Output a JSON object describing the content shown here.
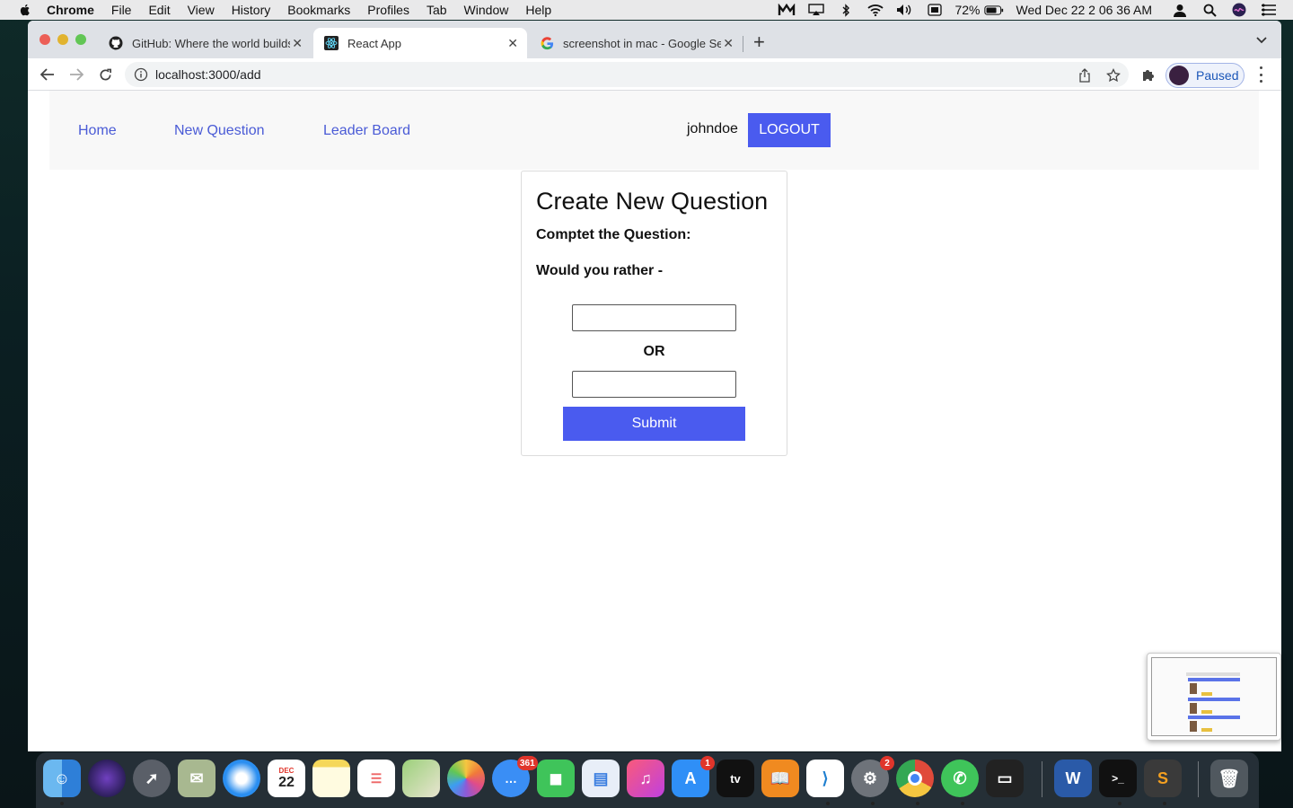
{
  "menubar": {
    "app": "Chrome",
    "items": [
      "File",
      "Edit",
      "View",
      "History",
      "Bookmarks",
      "Profiles",
      "Tab",
      "Window",
      "Help"
    ],
    "battery": "72%",
    "clock": "Wed Dec 22  2 06 36 AM"
  },
  "browser": {
    "tabs": [
      {
        "title": "GitHub: Where the world builds",
        "favicon": "github-icon"
      },
      {
        "title": "React App",
        "favicon": "react-icon"
      },
      {
        "title": "screenshot in mac - Google Se",
        "favicon": "google-icon"
      }
    ],
    "url": "localhost:3000/add",
    "profile_label": "Paused"
  },
  "app": {
    "nav": {
      "home": "Home",
      "new_question": "New Question",
      "leader_board": "Leader Board",
      "username": "johndoe",
      "logout": "LOGOUT"
    },
    "form": {
      "title": "Create New Question",
      "subtitle": "Comptet the Question:",
      "prompt": "Would you rather -",
      "option_one_value": "",
      "separator": "OR",
      "option_two_value": "",
      "submit": "Submit"
    }
  },
  "dock": {
    "badges": {
      "messages": "361",
      "app_store": "1",
      "system_preferences": "2"
    },
    "calendar_month": "DEC",
    "calendar_day": "22"
  },
  "colors": {
    "accent": "#4a5bef",
    "link": "#4a5bd6"
  }
}
